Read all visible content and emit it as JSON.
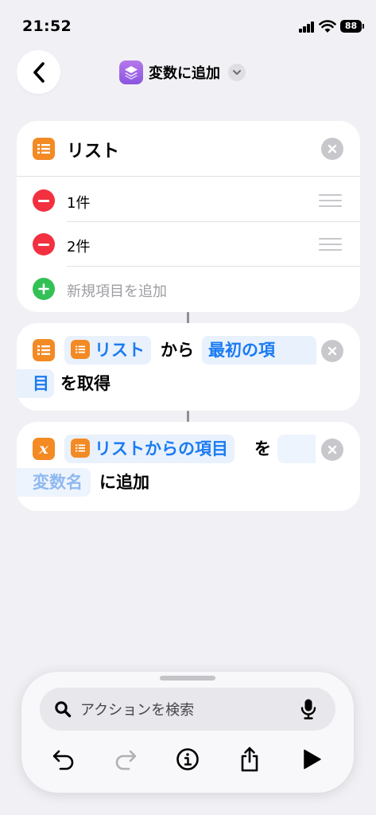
{
  "status_bar": {
    "time": "21:52",
    "battery": "88"
  },
  "header": {
    "title": "変数に追加"
  },
  "list_card": {
    "title": "リスト",
    "items": [
      {
        "label": "1件"
      },
      {
        "label": "2件"
      }
    ],
    "add_label": "新規項目を追加"
  },
  "get_action": {
    "variable": "リスト",
    "connector_1": "から",
    "mode_line1": "最初の項",
    "mode_line2": "目",
    "connector_2": "を取得"
  },
  "set_action": {
    "variable": "リストからの項目",
    "connector_1": "を",
    "variable_name_placeholder": "変数名",
    "connector_2": "に追加"
  },
  "bottom_panel": {
    "search_placeholder": "アクションを検索"
  },
  "colors": {
    "accent": "#1a7bf2",
    "orange": "#f38a24",
    "red": "#f2303f",
    "green": "#33c156",
    "purple": "#9a62e6"
  }
}
